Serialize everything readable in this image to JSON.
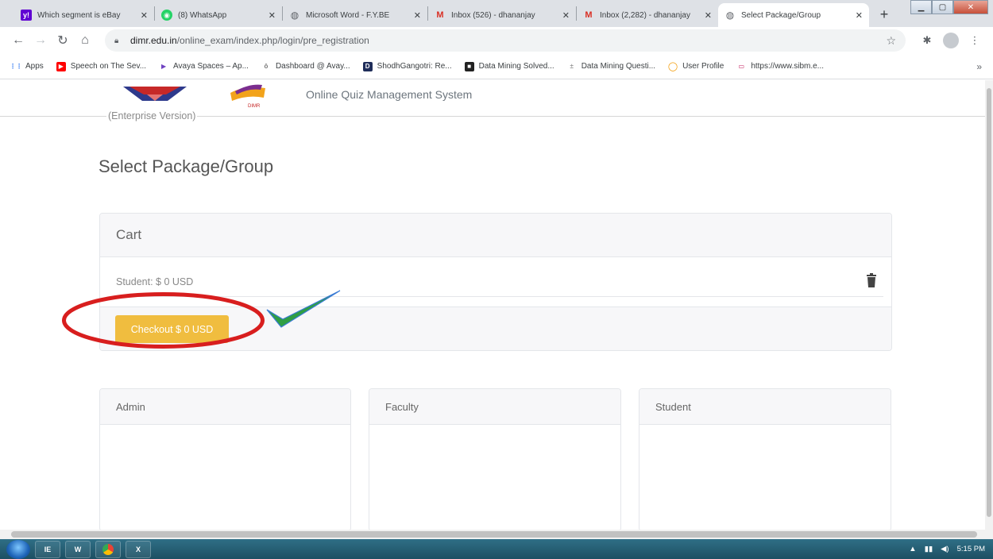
{
  "browser": {
    "tabs": [
      {
        "title": "Which segment is eBay",
        "favicon": "yahoo-icon",
        "color": "#6001d2",
        "glyph": "y!"
      },
      {
        "title": "(8) WhatsApp",
        "favicon": "whatsapp-icon",
        "color": "#25d366",
        "glyph": "◉"
      },
      {
        "title": "Microsoft Word - F.Y.BE",
        "favicon": "globe-icon",
        "color": "#5f6368",
        "glyph": "◍"
      },
      {
        "title": "Inbox (526) - dhananjay",
        "favicon": "gmail-icon",
        "color": "#d93025",
        "glyph": "M"
      },
      {
        "title": "Inbox (2,282) - dhananjay",
        "favicon": "gmail-icon",
        "color": "#d93025",
        "glyph": "M"
      },
      {
        "title": "Select Package/Group",
        "favicon": "globe-icon",
        "color": "#5f6368",
        "glyph": "◍"
      }
    ],
    "new_tab": "+",
    "url_host": "dimr.edu.in",
    "url_path": "/online_exam/index.php/login/pre_registration",
    "bookmarks": [
      {
        "label": "Apps",
        "color": "#4285f4",
        "glyph": "⋮⋮"
      },
      {
        "label": "Speech on The Sev...",
        "color": "#ff0000",
        "glyph": "▶"
      },
      {
        "label": "Avaya Spaces – Ap...",
        "color": "#6f42c1",
        "glyph": "▶"
      },
      {
        "label": "Dashboard @ Avay...",
        "color": "#777777",
        "glyph": "ô"
      },
      {
        "label": "ShodhGangotri: Re...",
        "color": "#1f2d5a",
        "glyph": "D"
      },
      {
        "label": "Data Mining Solved...",
        "color": "#222222",
        "glyph": "■"
      },
      {
        "label": "Data Mining Questi...",
        "color": "#999999",
        "glyph": "±"
      },
      {
        "label": "User Profile",
        "color": "#f29900",
        "glyph": "◯"
      },
      {
        "label": "https://www.sibm.e...",
        "color": "#c2185b",
        "glyph": "▭"
      }
    ],
    "bookmarks_more": "»"
  },
  "site": {
    "title": "Online Quiz Management System",
    "edition": "(Enterprise Version)"
  },
  "main": {
    "heading": "Select Package/Group",
    "cart": {
      "header": "Cart",
      "line_item": "Student: $ 0 USD",
      "checkout_label": "Checkout $ 0 USD"
    },
    "roles": [
      "Admin",
      "Faculty",
      "Student"
    ]
  },
  "colors": {
    "checkout": "#f0bd3f",
    "annotation_ellipse": "#d81e1e",
    "annotation_check": "#2f9e44"
  },
  "taskbar": {
    "apps": [
      "IE",
      "W",
      "Chrome",
      "X"
    ],
    "time": "5:15 PM"
  }
}
